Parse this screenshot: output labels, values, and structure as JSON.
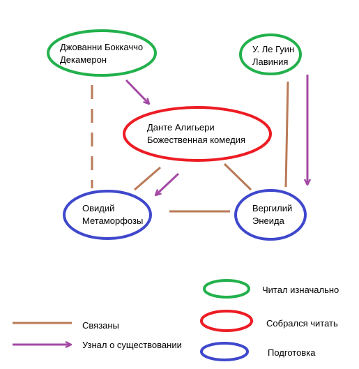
{
  "nodes": {
    "boccaccio": {
      "line1": "Джованни Боккаччо",
      "line2": "Декамерон",
      "color": "#22b14c"
    },
    "leguin": {
      "line1": "У. Ле Гуин",
      "line2": "Лавиния",
      "color": "#22b14c"
    },
    "dante": {
      "line1": "Данте Алигьери",
      "line2": "Божественная комедия",
      "color": "#ed1c24"
    },
    "ovid": {
      "line1": "Овидий",
      "line2": "Метаморфозы",
      "color": "#3f48cc"
    },
    "virgil": {
      "line1": "Вергилий",
      "line2": "Энеида",
      "color": "#3f48cc"
    }
  },
  "edge_colors": {
    "related": "#b97a57",
    "learned": "#a349a4"
  },
  "legend": {
    "related": "Связаны",
    "learned": "Узнал о существовании",
    "read_initially": "Читал изначально",
    "decided_to_read": "Собрался читать",
    "preparation": "Подготовка"
  }
}
